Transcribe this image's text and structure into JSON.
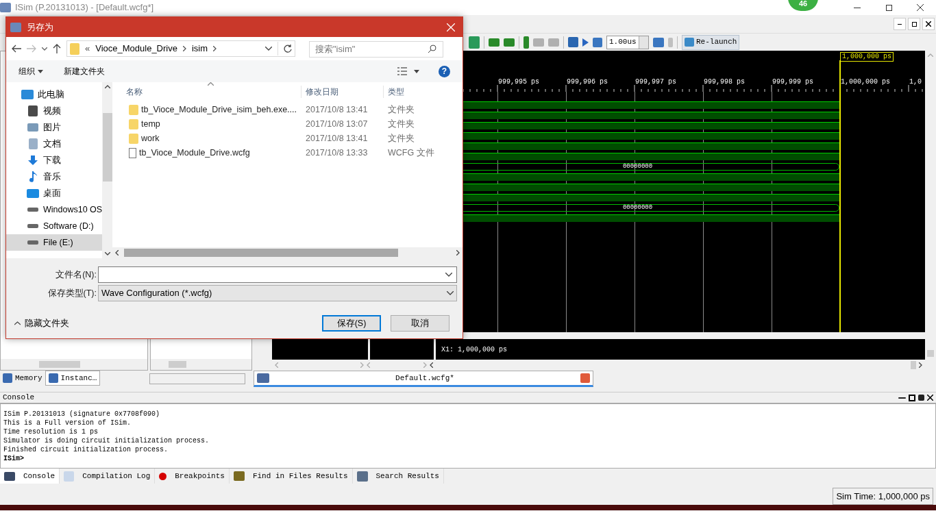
{
  "window": {
    "title": "ISim (P.20131013) - [Default.wcfg*]",
    "badge": "46"
  },
  "toolbar": {
    "time_value": "1.00us",
    "relaunch": "Re-launch"
  },
  "wave": {
    "cursor_label": "1,000,000 ps",
    "ruler": [
      {
        "label": "999,995 ps"
      },
      {
        "label": "999,996 ps"
      },
      {
        "label": "999,997 ps"
      },
      {
        "label": "999,998 ps"
      },
      {
        "label": "999,999 ps"
      },
      {
        "label": "1,000,000 ps"
      },
      {
        "label": "1,0"
      }
    ],
    "signals": [
      {
        "kind": "bit"
      },
      {
        "kind": "bit"
      },
      {
        "kind": "bit"
      },
      {
        "kind": "bit"
      },
      {
        "kind": "bit"
      },
      {
        "kind": "bit"
      },
      {
        "kind": "bus",
        "value": "00000000"
      },
      {
        "kind": "bit"
      },
      {
        "kind": "bit"
      },
      {
        "kind": "bit"
      },
      {
        "kind": "bus",
        "value": "00000000"
      },
      {
        "kind": "bit"
      }
    ],
    "x1": "X1: 1,000,000 ps"
  },
  "left_tabs": [
    {
      "label": "Memory",
      "selected": false
    },
    {
      "label": "Instanc…",
      "selected": true
    }
  ],
  "doc_tab": {
    "label": "Default.wcfg*"
  },
  "console": {
    "title": "Console",
    "lines": [
      {
        "text": "ISim P.20131013 (signature 0x7708f090)",
        "bold": false
      },
      {
        "text": "This is a Full version of ISim.",
        "bold": false
      },
      {
        "text": "Time resolution is 1 ps",
        "bold": false
      },
      {
        "text": "Simulator is doing circuit initialization process.",
        "bold": false
      },
      {
        "text": "Finished circuit initialization process.",
        "bold": false
      },
      {
        "text": "ISim>",
        "bold": true
      }
    ]
  },
  "bottom_tabs": [
    {
      "label": "Console",
      "kind": "console",
      "selected": true
    },
    {
      "label": "Compilation Log",
      "kind": "log",
      "selected": false
    },
    {
      "label": "Breakpoints",
      "kind": "breakpoint",
      "selected": false
    },
    {
      "label": "Find in Files Results",
      "kind": "find",
      "selected": false
    },
    {
      "label": "Search Results",
      "kind": "search",
      "selected": false
    }
  ],
  "status_bar": {
    "sim_time": "Sim Time: 1,000,000 ps"
  },
  "dialog": {
    "title": "另存为",
    "path": [
      "Vioce_Module_Drive",
      "isim"
    ],
    "path_prefix": "«",
    "search": {
      "placeholder": "搜索\"isim\""
    },
    "help": "?",
    "organize": "组织",
    "new_folder": "新建文件夹",
    "nav": [
      {
        "label": "此电脑",
        "kind": "pc",
        "selected": false
      },
      {
        "label": "视频",
        "kind": "video",
        "selected": false
      },
      {
        "label": "图片",
        "kind": "picture",
        "selected": false
      },
      {
        "label": "文档",
        "kind": "doc",
        "selected": false
      },
      {
        "label": "下载",
        "kind": "download",
        "selected": false
      },
      {
        "label": "音乐",
        "kind": "music",
        "selected": false
      },
      {
        "label": "桌面",
        "kind": "desktop",
        "selected": false
      },
      {
        "label": "Windows10 OS",
        "kind": "drive",
        "selected": false
      },
      {
        "label": "Software (D:)",
        "kind": "drive",
        "selected": false
      },
      {
        "label": "File (E:)",
        "kind": "drive",
        "selected": true
      }
    ],
    "columns": [
      "名称",
      "修改日期",
      "类型"
    ],
    "files": [
      {
        "name": "tb_Vioce_Module_Drive_isim_beh.exe....",
        "date": "2017/10/8 13:41",
        "type": "文件夹",
        "kind": "folder"
      },
      {
        "name": "temp",
        "date": "2017/10/8 13:07",
        "type": "文件夹",
        "kind": "folder"
      },
      {
        "name": "work",
        "date": "2017/10/8 13:41",
        "type": "文件夹",
        "kind": "folder"
      },
      {
        "name": "tb_Vioce_Module_Drive.wcfg",
        "date": "2017/10/8 13:33",
        "type": "WCFG 文件",
        "kind": "file"
      }
    ],
    "filename_label": "文件名(N):",
    "type_label": "保存类型(T):",
    "type_value": "Wave Configuration (*.wcfg)",
    "hide_folders": "隐藏文件夹",
    "save": "保存(S)",
    "cancel": "取消"
  }
}
